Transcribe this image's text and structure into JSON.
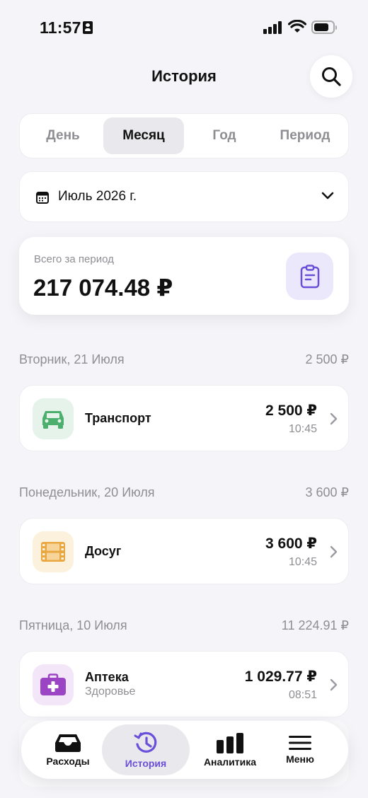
{
  "status": {
    "time": "11:57"
  },
  "header": {
    "title": "История"
  },
  "tabs": [
    {
      "label": "День"
    },
    {
      "label": "Месяц"
    },
    {
      "label": "Год"
    },
    {
      "label": "Период"
    }
  ],
  "month": {
    "label": "Июль 2026 г."
  },
  "total": {
    "label": "Всего за период",
    "amount": "217 074.48 ₽"
  },
  "days": [
    {
      "date": "Вторник, 21 Июля",
      "sum": "2 500 ₽",
      "items": [
        {
          "name": "Транспорт",
          "amount": "2 500 ₽",
          "time": "10:45",
          "icon": "car-icon",
          "color": "#4caf6e"
        }
      ]
    },
    {
      "date": "Понедельник, 20 Июля",
      "sum": "3 600 ₽",
      "items": [
        {
          "name": "Досуг",
          "amount": "3 600 ₽",
          "time": "10:45",
          "icon": "film-icon",
          "color": "#e9a83f"
        }
      ]
    },
    {
      "date": "Пятница, 10 Июля",
      "sum": "11 224.91 ₽",
      "items": [
        {
          "name": "Аптека",
          "sub": "Здоровье",
          "amount": "1 029.77 ₽",
          "time": "08:51",
          "icon": "medkit-icon",
          "color": "#9b45c4"
        }
      ]
    }
  ],
  "nav": [
    {
      "label": "Расходы",
      "icon": "inbox-icon"
    },
    {
      "label": "История",
      "icon": "history-icon"
    },
    {
      "label": "Аналитика",
      "icon": "bar-chart-icon"
    },
    {
      "label": "Меню",
      "icon": "menu-icon"
    }
  ],
  "colors": {
    "accent": "#6a4fd8",
    "muted": "#8e8e93"
  }
}
